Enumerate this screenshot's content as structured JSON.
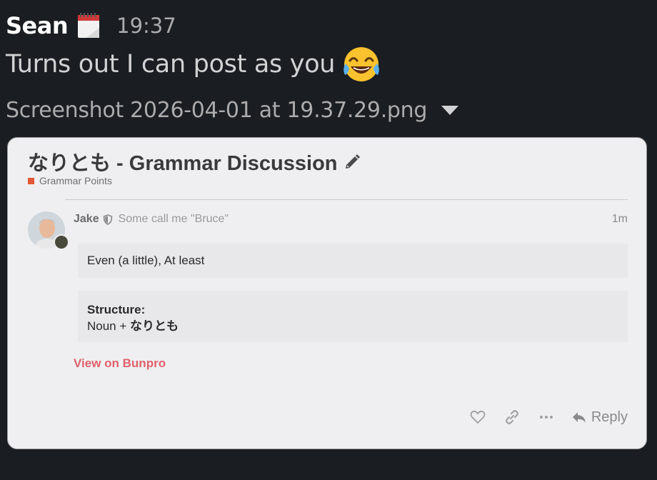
{
  "message": {
    "author": "Sean",
    "status_icon": "calendar-icon",
    "time": "19:37",
    "text": "Turns out I can post as you",
    "emoji": "joy-emoji"
  },
  "attachment": {
    "filename": "Screenshot 2026-04-01 at 19.37.29.png",
    "toggle_icon": "caret-down-icon"
  },
  "forum_post": {
    "topic_title": "なりとも - Grammar Discussion",
    "category": "Grammar Points",
    "category_color": "#e45735",
    "poster": {
      "name": "Jake",
      "title": "Some call me \"Bruce\"",
      "age": "1m"
    },
    "meaning": "Even (a little), At least",
    "structure_label": "Structure:",
    "structure_prefix": "Noun + ",
    "structure_value": "なりとも",
    "link_text": "View on Bunpro",
    "link_color": "#e0606a",
    "reply_label": "Reply"
  }
}
